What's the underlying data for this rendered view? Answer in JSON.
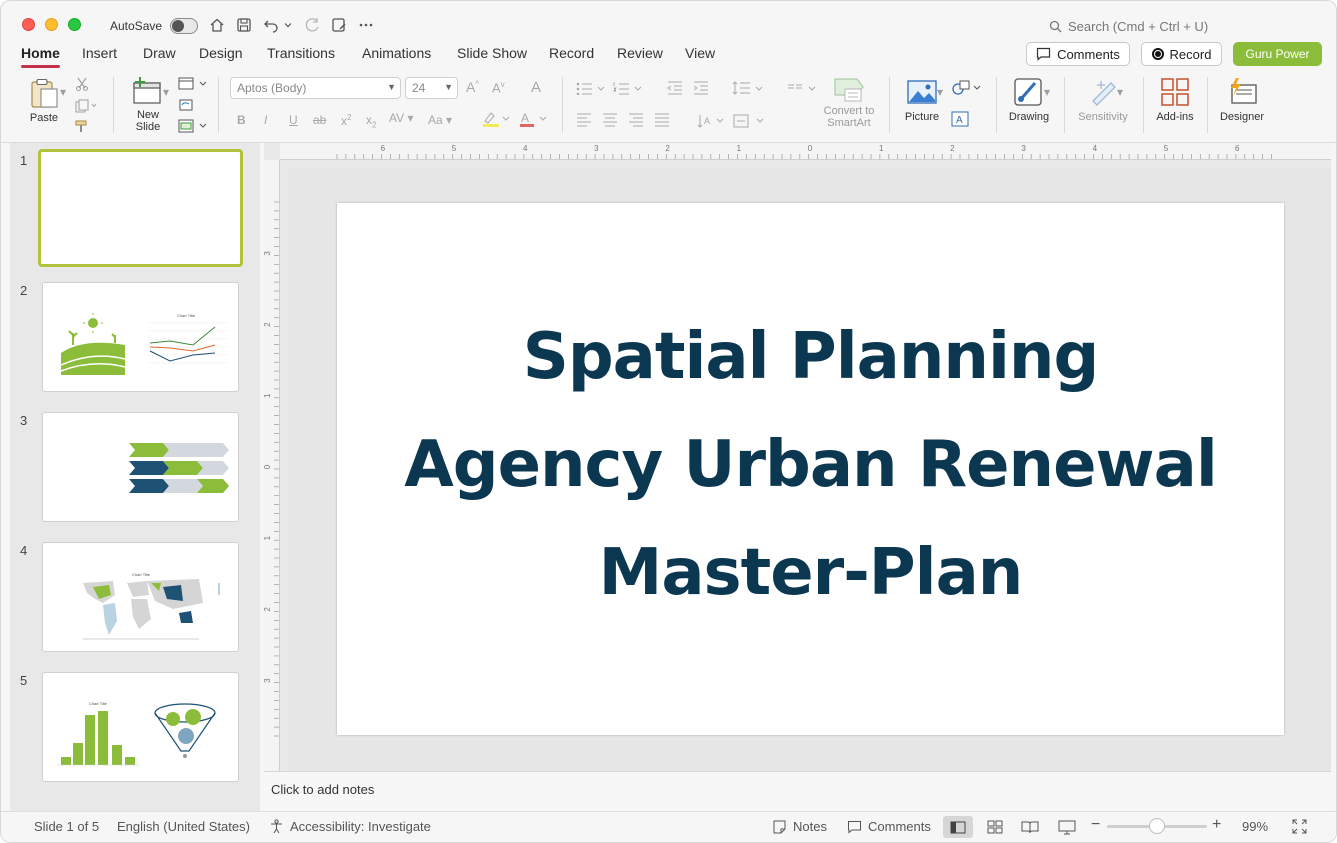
{
  "titlebar": {
    "autosave_label": "AutoSave",
    "search_placeholder": "Search (Cmd + Ctrl + U)"
  },
  "tabs": [
    "Home",
    "Insert",
    "Draw",
    "Design",
    "Transitions",
    "Animations",
    "Slide Show",
    "Record",
    "Review",
    "View"
  ],
  "active_tab": "Home",
  "top_buttons": {
    "comments": "Comments",
    "record": "Record",
    "guru": "Guru Power"
  },
  "ribbon": {
    "paste": "Paste",
    "new_slide": "New\nSlide",
    "font_name": "Aptos (Body)",
    "font_size": "24",
    "convert_smartart": "Convert to\nSmartArt",
    "picture": "Picture",
    "drawing": "Drawing",
    "sensitivity": "Sensitivity",
    "add_ins": "Add-ins",
    "designer": "Designer"
  },
  "thumbnails": [
    {
      "number": "1"
    },
    {
      "number": "2"
    },
    {
      "number": "3"
    },
    {
      "number": "4"
    },
    {
      "number": "5"
    }
  ],
  "thumb_text": {
    "chart_title": "Chart Title"
  },
  "slide": {
    "title_line1": "Spatial Planning",
    "title_line2": "Agency Urban Renewal",
    "title_line3": "Master-Plan"
  },
  "ruler": {
    "top_labels": [
      "6",
      "5",
      "4",
      "3",
      "2",
      "1",
      "0",
      "1",
      "2",
      "3",
      "4",
      "5",
      "6"
    ],
    "left_labels": [
      "3",
      "2",
      "1",
      "0",
      "1",
      "2",
      "3"
    ]
  },
  "notes_placeholder": "Click to add notes",
  "statusbar": {
    "slide_info": "Slide 1 of 5",
    "language": "English (United States)",
    "accessibility": "Accessibility: Investigate",
    "notes": "Notes",
    "comments": "Comments",
    "zoom": "99%",
    "zoom_fraction": 0.5
  },
  "colors": {
    "accent_green": "#8cbd3a",
    "title_navy": "#0b3850",
    "tab_underline": "#c4314b"
  }
}
